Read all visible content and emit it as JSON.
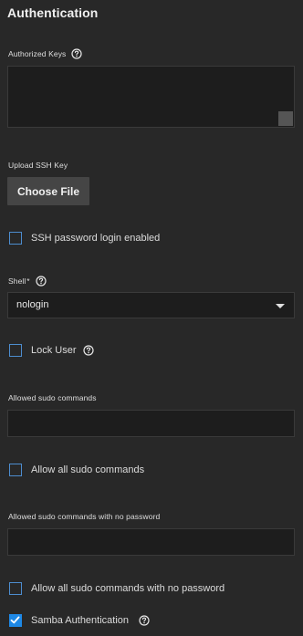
{
  "section": {
    "title": "Authentication"
  },
  "authorized_keys": {
    "label": "Authorized Keys",
    "value": ""
  },
  "upload_ssh_key": {
    "label": "Upload SSH Key",
    "button_label": "Choose File"
  },
  "ssh_password_login": {
    "label": "SSH password login enabled",
    "checked": false
  },
  "shell": {
    "label": "Shell",
    "required_marker": "*",
    "selected_value": "nologin"
  },
  "lock_user": {
    "label": "Lock User",
    "checked": false
  },
  "allowed_sudo_commands": {
    "label": "Allowed sudo commands",
    "value": ""
  },
  "allow_all_sudo": {
    "label": "Allow all sudo commands",
    "checked": false
  },
  "allowed_sudo_nopasswd": {
    "label": "Allowed sudo commands with no password",
    "value": ""
  },
  "allow_all_sudo_nopasswd": {
    "label": "Allow all sudo commands with no password",
    "checked": false
  },
  "samba_auth": {
    "label": "Samba Authentication",
    "checked": true
  },
  "icons": {
    "help": "help-circle-icon",
    "check": "check-icon",
    "dropdown": "chevron-down-icon"
  },
  "colors": {
    "background": "#282828",
    "field": "#1d1d1d",
    "accent": "#1e88e5",
    "button": "#454545"
  }
}
